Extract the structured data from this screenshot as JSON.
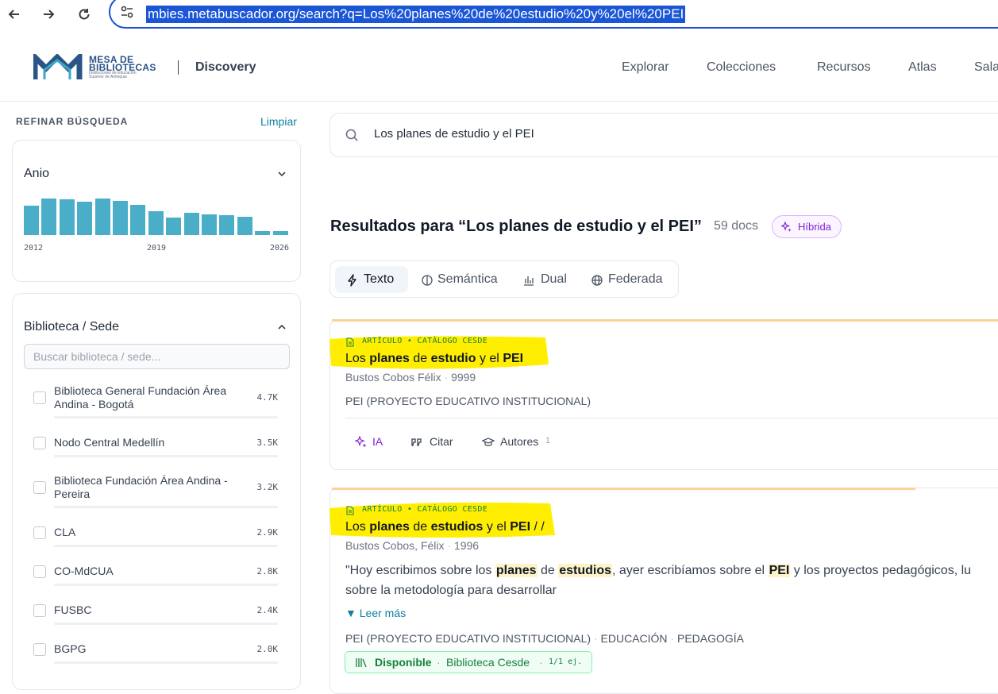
{
  "browser": {
    "url": "mbies.metabuscador.org/search?q=Los%20planes%20de%20estudio%20y%20el%20PEI",
    "back_icon": "arrow-left-icon",
    "forward_icon": "arrow-right-icon",
    "reload_icon": "reload-icon"
  },
  "header": {
    "logo_line1": "MESA DE",
    "logo_line2": "BIBLIOTECAS",
    "logo_sub": "Instituciones de Educación Superior de Antioquia",
    "site_name": "Discovery",
    "nav": [
      "Explorar",
      "Colecciones",
      "Recursos",
      "Atlas",
      "Sala"
    ]
  },
  "sidebar": {
    "title": "REFINAR BÚSQUEDA",
    "clear": "Limpiar",
    "year": {
      "title": "Anio",
      "labels": [
        "2012",
        "2019",
        "2026"
      ],
      "bar_levels": [
        0.78,
        0.95,
        0.93,
        0.88,
        0.95,
        0.9,
        0.79,
        0.63,
        0.46,
        0.59,
        0.54,
        0.53,
        0.47,
        0.11,
        0.11
      ]
    },
    "library": {
      "title": "Biblioteca / Sede",
      "placeholder": "Buscar biblioteca / sede...",
      "items": [
        {
          "name": "Biblioteca General Fundación Área Andina - Bogotá",
          "count": "4.7K"
        },
        {
          "name": "Nodo Central Medellín",
          "count": "3.5K"
        },
        {
          "name": "Biblioteca Fundación Área Andina - Pereira",
          "count": "3.2K"
        },
        {
          "name": "CLA",
          "count": "2.9K"
        },
        {
          "name": "CO-MdCUA",
          "count": "2.8K"
        },
        {
          "name": "FUSBC",
          "count": "2.4K"
        },
        {
          "name": "BGPG",
          "count": "2.0K"
        }
      ]
    }
  },
  "main": {
    "query": "Los planes de estudio y el PEI",
    "results_title": "Resultados para “Los planes de estudio y el PEI”",
    "results_count": "59 docs",
    "mode_badge": "Híbrida",
    "tabs": [
      "Texto",
      "Semántica",
      "Dual",
      "Federada"
    ],
    "results": [
      {
        "type": "ARTÍCULO • CATÁLOGO CESDE",
        "title_parts": [
          "Los ",
          "planes",
          " de ",
          "estudio",
          " y el ",
          "PEI"
        ],
        "author": "Bustos Cobos Félix",
        "year": "9999",
        "subjects": "PEI (PROYECTO EDUCATIVO INSTITUCIONAL)",
        "actions": {
          "ai": "IA",
          "cite": "Citar",
          "authors": "Autores",
          "authors_count": "1"
        }
      },
      {
        "type": "ARTÍCULO • CATÁLOGO CESDE",
        "title_parts": [
          "Los ",
          "planes",
          " de ",
          "estudios",
          " y el ",
          "PEI",
          " / /"
        ],
        "author": "Bustos Cobos, Félix",
        "year": "1996",
        "snippet_line1_parts": [
          "\"Hoy escribimos sobre los ",
          "planes",
          " de ",
          "estudios",
          ", ayer escribíamos sobre el ",
          "PEI",
          " y los proyectos pedagógicos, lu"
        ],
        "snippet_line2": "sobre la metodología para desarrollar",
        "read_more": "Leer más",
        "subjects": [
          "PEI (PROYECTO EDUCATIVO INSTITUCIONAL)",
          "EDUCACIÓN",
          "PEDAGOGÍA"
        ],
        "availability": {
          "status": "Disponible",
          "library": "Biblioteca Cesde",
          "copies": "1/1 ej."
        }
      }
    ]
  }
}
